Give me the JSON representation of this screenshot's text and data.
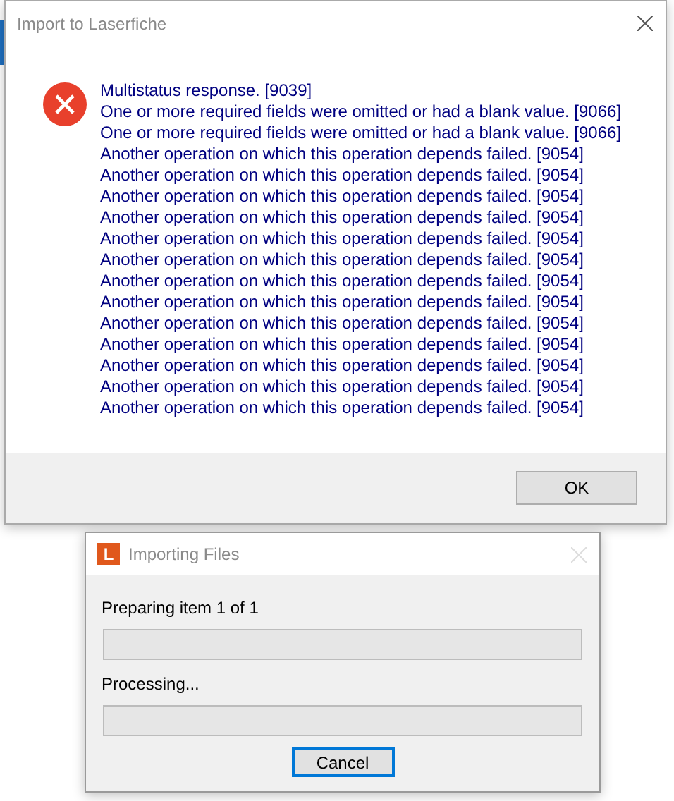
{
  "error_dialog": {
    "title": "Import to Laserfiche",
    "messages": [
      "Multistatus response. [9039]",
      "One or more required fields were omitted or had a blank value. [9066]",
      "One or more required fields were omitted or had a blank value. [9066]",
      "Another operation on which this operation depends failed. [9054]",
      "Another operation on which this operation depends failed. [9054]",
      "Another operation on which this operation depends failed. [9054]",
      "Another operation on which this operation depends failed. [9054]",
      "Another operation on which this operation depends failed. [9054]",
      "Another operation on which this operation depends failed. [9054]",
      "Another operation on which this operation depends failed. [9054]",
      "Another operation on which this operation depends failed. [9054]",
      "Another operation on which this operation depends failed. [9054]",
      "Another operation on which this operation depends failed. [9054]",
      "Another operation on which this operation depends failed. [9054]",
      "Another operation on which this operation depends failed. [9054]",
      "Another operation on which this operation depends failed. [9054]"
    ],
    "button": "OK"
  },
  "progress_dialog": {
    "app_icon": "L",
    "title": "Importing Files",
    "stages": [
      {
        "label": "Preparing item 1 of 1",
        "level": 0
      },
      {
        "label": "Processing...",
        "level": 0
      }
    ],
    "button": "Cancel"
  }
}
